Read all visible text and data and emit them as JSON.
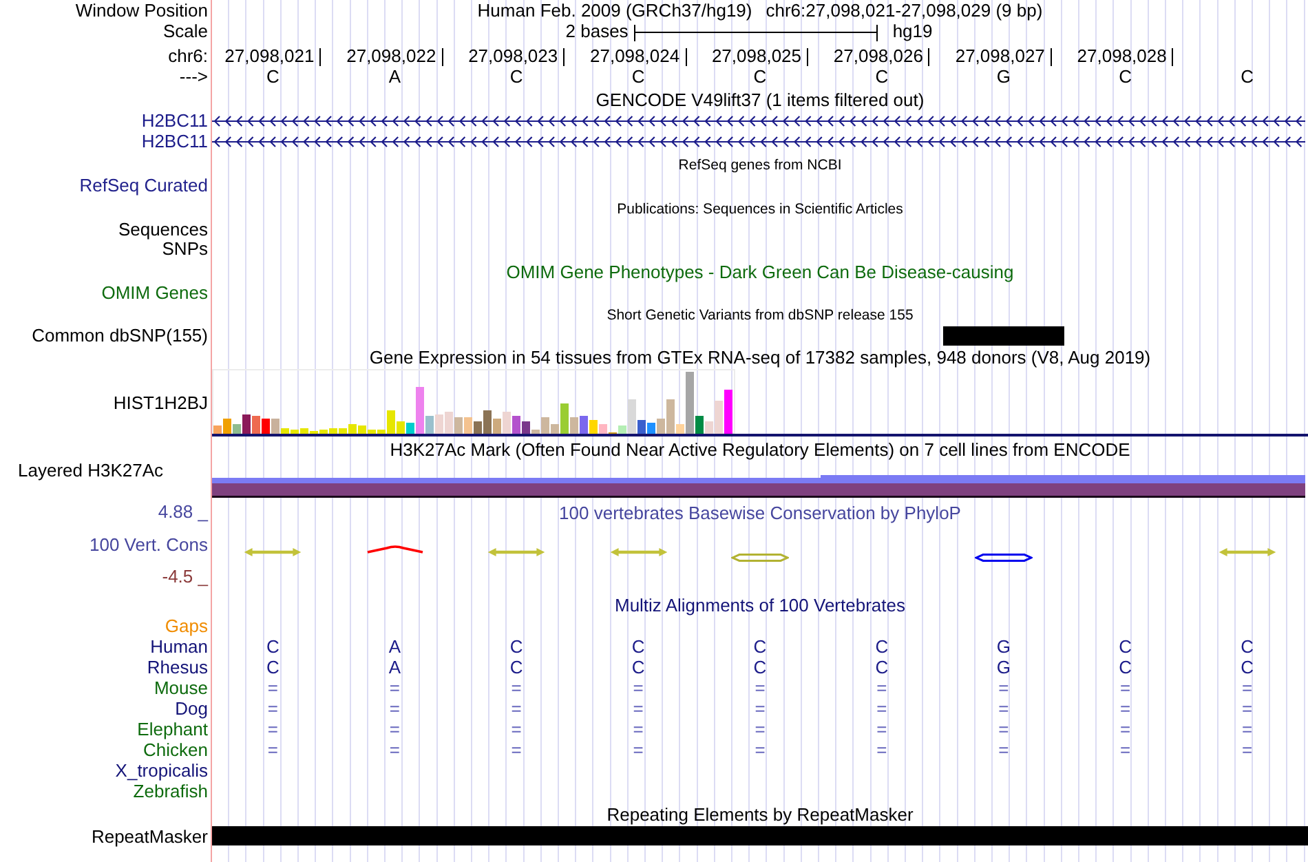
{
  "rows": [
    {
      "kind": "position",
      "label": "Window Position",
      "assembly": "Human Feb. 2009 (GRCh37/hg19)",
      "range": "chr6:27,098,021-27,098,029 (9 bp)"
    },
    {
      "kind": "scale",
      "label": "Scale",
      "length": "2 bases",
      "assembly": "hg19"
    },
    {
      "kind": "coords",
      "label": "chr6:",
      "positions": [
        "27,098,021",
        "27,098,022",
        "27,098,023",
        "27,098,024",
        "27,098,025",
        "27,098,026",
        "27,098,027",
        "27,098,028"
      ]
    },
    {
      "kind": "bases",
      "label": "--->",
      "bases": [
        "C",
        "A",
        "C",
        "C",
        "C",
        "C",
        "G",
        "C",
        "C"
      ]
    },
    {
      "kind": "title",
      "text": "GENCODE V49lift37 (1 items filtered out)"
    },
    {
      "kind": "gene",
      "label": "H2BC11",
      "color": "#1c1c8a"
    },
    {
      "kind": "gene",
      "label": "H2BC11",
      "color": "#1c1c8a"
    },
    {
      "kind": "subtitle",
      "text": "RefSeq genes from NCBI"
    },
    {
      "kind": "track",
      "label": "RefSeq Curated",
      "color": "#22228c"
    },
    {
      "kind": "subtitle",
      "text": "Publications: Sequences in Scientific Articles"
    },
    {
      "kind": "track",
      "label": "Sequences",
      "color": "#000000"
    },
    {
      "kind": "track",
      "label": "SNPs",
      "color": "#000000"
    },
    {
      "kind": "title",
      "text": "OMIM Gene Phenotypes - Dark Green Can Be Disease-causing",
      "color": "#0e6b0e"
    },
    {
      "kind": "track",
      "label": "OMIM Genes",
      "color": "#0e6b0e"
    },
    {
      "kind": "subtitle",
      "text": "Short Genetic Variants from dbSNP release 155"
    },
    {
      "kind": "snp",
      "label": "Common dbSNP(155)",
      "color": "#000000",
      "sites": [
        false,
        false,
        false,
        false,
        false,
        false,
        true,
        false,
        false
      ]
    },
    {
      "kind": "title",
      "text": "Gene Expression in 54 tissues from GTEx RNA-seq of 17382 samples, 948 donors (V8, Aug 2019)"
    },
    {
      "kind": "expression",
      "label": "HIST1H2BJ",
      "color": "#000000"
    },
    {
      "kind": "title",
      "text": "H3K27Ac Mark (Often Found Near Active Regulatory Elements) on 7 cell lines from ENCODE"
    },
    {
      "kind": "layered",
      "label": "Layered H3K27Ac",
      "color": "#000000"
    },
    {
      "kind": "phylop",
      "title": "100 vertebrates Basewise Conservation by PhyloP",
      "label": "100 Vert. Cons",
      "max": "4.88 _",
      "min": {
        "text": "-4.5 _",
        "color": "#8b3a3a"
      },
      "color": "#46469e",
      "glyphs": [
        {
          "kind": "thin",
          "color": "#c2c23a"
        },
        {
          "kind": "peak",
          "color": "#ff0000"
        },
        {
          "kind": "thin",
          "color": "#c2c23a"
        },
        {
          "kind": "thin",
          "color": "#c2c23a"
        },
        {
          "kind": "hollow",
          "color": "#b2b232"
        },
        {
          "kind": "none"
        },
        {
          "kind": "hollow",
          "color": "#0000ee"
        },
        {
          "kind": "none"
        },
        {
          "kind": "thin",
          "color": "#c2c23a"
        }
      ]
    },
    {
      "kind": "title",
      "text": "Multiz Alignments of 100 Vertebrates",
      "color": "#141478"
    },
    {
      "kind": "species",
      "label": "Gaps",
      "color": "#f08c00"
    },
    {
      "kind": "species",
      "label": "Human",
      "color": "#141478",
      "alignment": {
        "kind": "letters",
        "bases": [
          "C",
          "A",
          "C",
          "C",
          "C",
          "C",
          "G",
          "C",
          "C"
        ]
      }
    },
    {
      "kind": "species",
      "label": "Rhesus",
      "color": "#141478",
      "alignment": {
        "kind": "letters",
        "bases": [
          "C",
          "A",
          "C",
          "C",
          "C",
          "C",
          "G",
          "C",
          "C"
        ]
      }
    },
    {
      "kind": "species",
      "label": "Mouse",
      "color": "#0e6b0e",
      "alignment": {
        "kind": "identical",
        "bases": [
          "=",
          "=",
          "=",
          "=",
          "=",
          "=",
          "=",
          "=",
          "="
        ]
      }
    },
    {
      "kind": "species",
      "label": "Dog",
      "color": "#141478",
      "alignment": {
        "kind": "identical",
        "bases": [
          "=",
          "=",
          "=",
          "=",
          "=",
          "=",
          "=",
          "=",
          "="
        ]
      }
    },
    {
      "kind": "species",
      "label": "Elephant",
      "color": "#0e6b0e",
      "alignment": {
        "kind": "identical",
        "bases": [
          "=",
          "=",
          "=",
          "=",
          "=",
          "=",
          "=",
          "=",
          "="
        ]
      }
    },
    {
      "kind": "species",
      "label": "Chicken",
      "color": "#0e6b0e",
      "alignment": {
        "kind": "identical",
        "bases": [
          "=",
          "=",
          "=",
          "=",
          "=",
          "=",
          "=",
          "=",
          "="
        ]
      }
    },
    {
      "kind": "species",
      "label": "X_tropicalis",
      "color": "#141478"
    },
    {
      "kind": "species",
      "label": "Zebrafish",
      "color": "#0e6b0e"
    },
    {
      "kind": "title",
      "text": "Repeating Elements by RepeatMasker"
    },
    {
      "kind": "repeat",
      "label": "RepeatMasker",
      "color": "#000000"
    }
  ]
}
